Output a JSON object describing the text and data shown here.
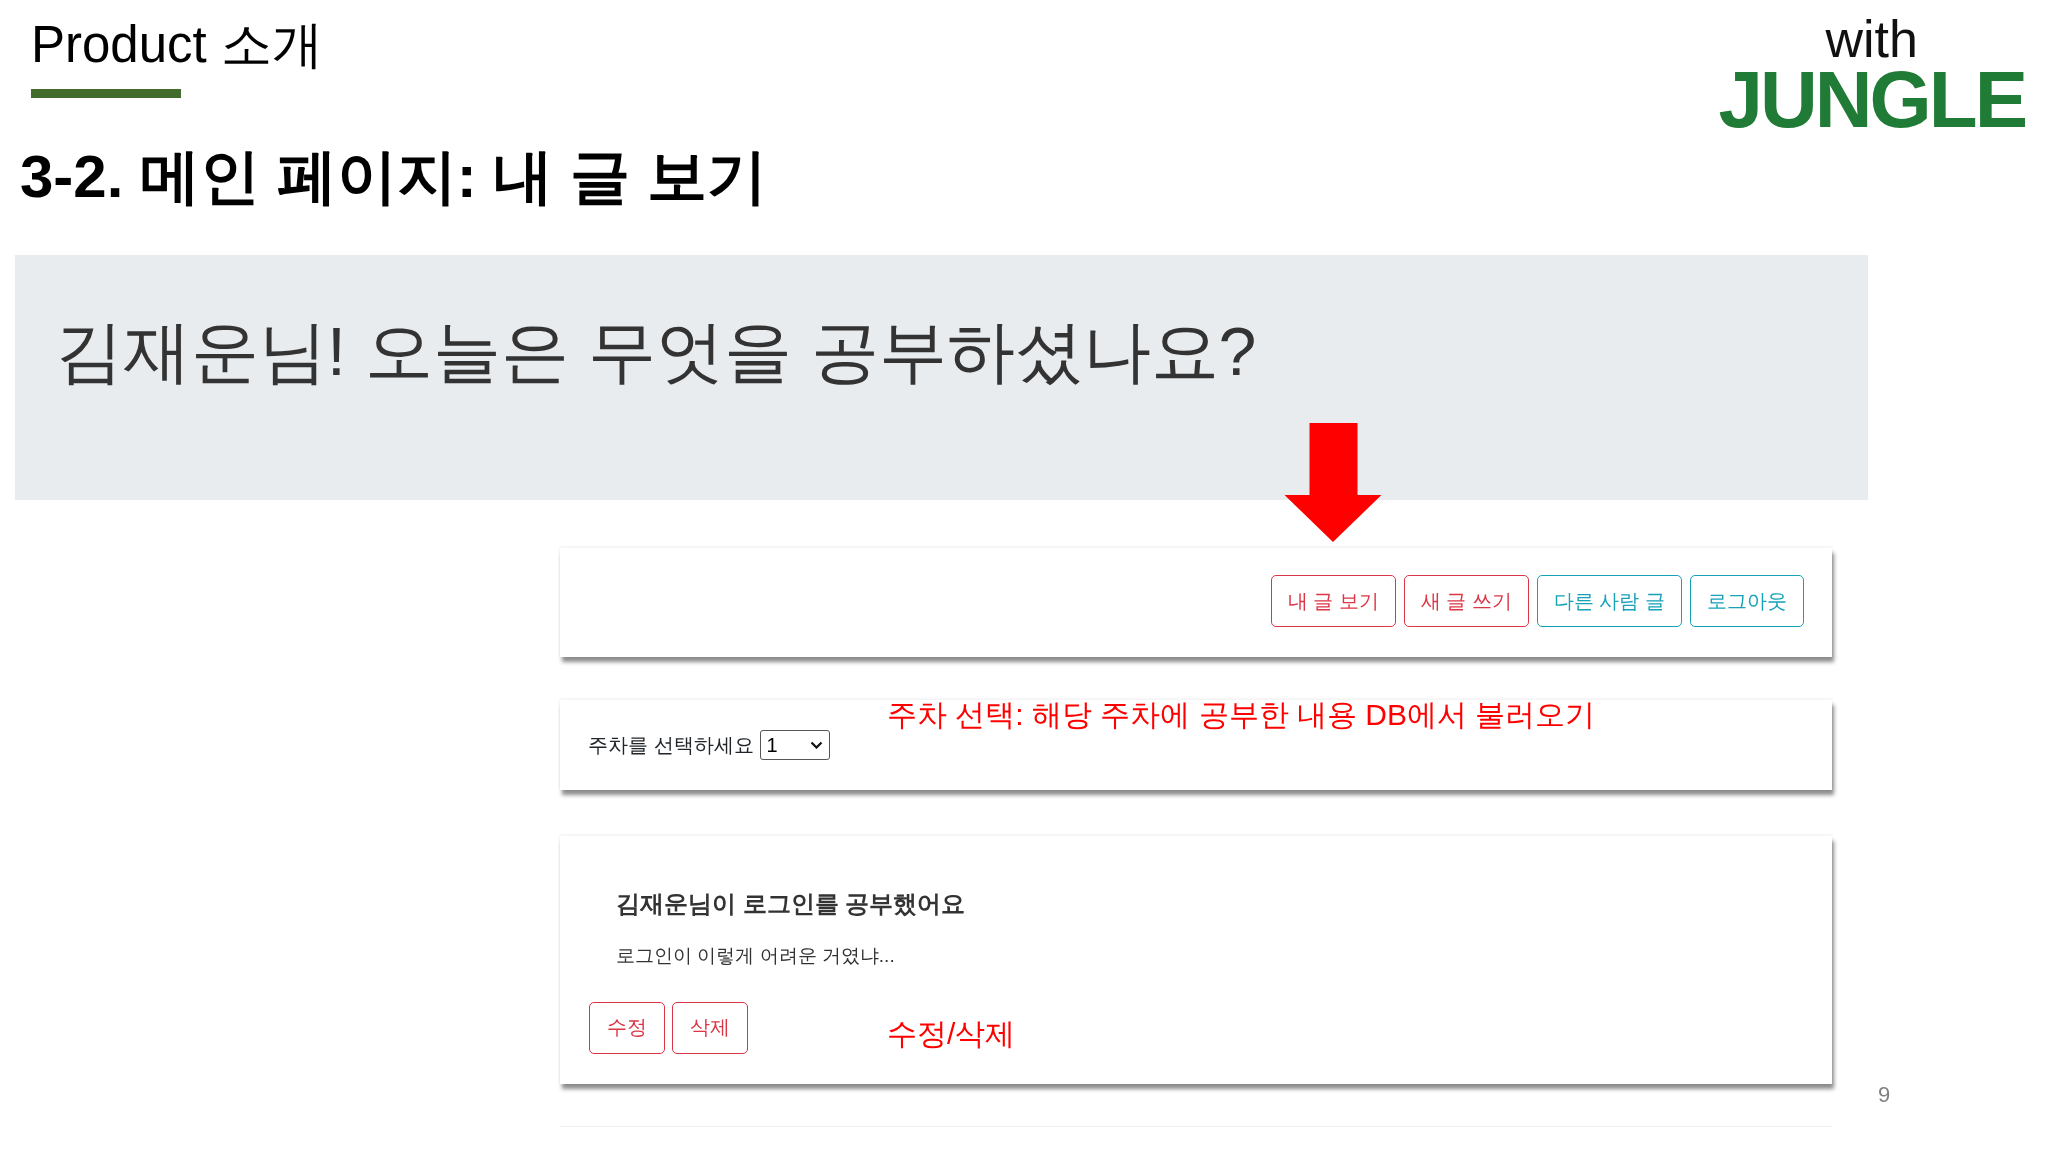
{
  "slide": {
    "section": "Product 소개",
    "title": "3-2. 메인 페이지: 내 글 보기",
    "logo": {
      "prefix": "with",
      "name": "JUNGLE"
    },
    "page_number": "9"
  },
  "app": {
    "greeting": "김재운님! 오늘은 무엇을 공부하셨나요?",
    "nav_buttons": [
      {
        "label": "내 글 보기",
        "kind": "danger",
        "highlighted": true
      },
      {
        "label": "새 글 쓰기",
        "kind": "danger",
        "highlighted": false
      },
      {
        "label": "다른 사람 글",
        "kind": "info",
        "highlighted": false
      },
      {
        "label": "로그아웃",
        "kind": "info",
        "highlighted": false
      }
    ],
    "week_select": {
      "label": "주차를 선택하세요",
      "value": "1",
      "callout": "주차 선택: 해당 주차에 공부한 내용 DB에서 불러오기"
    },
    "posts": [
      {
        "title": "김재운님이 로그인를 공부했어요",
        "body": "로그인이 이렇게 어려운 거였냐...",
        "actions": [
          {
            "label": "수정",
            "kind": "danger"
          },
          {
            "label": "삭제",
            "kind": "danger"
          }
        ],
        "callout": "수정/삭제"
      }
    ]
  }
}
